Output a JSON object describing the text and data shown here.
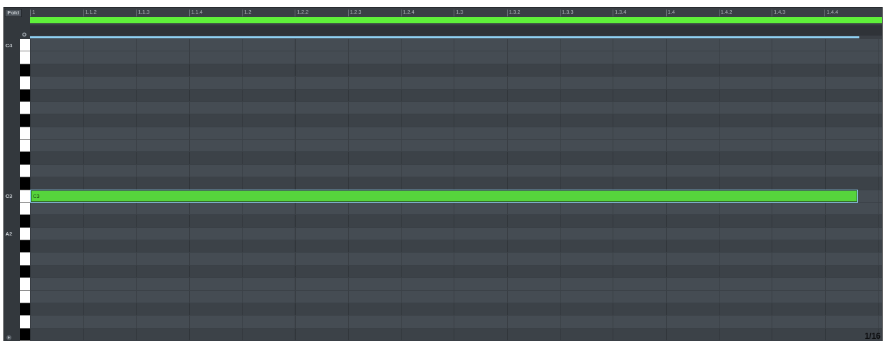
{
  "fold_button": "Fold",
  "ruler": [
    "1",
    "1.1.2",
    "1.1.3",
    "1.1.4",
    "1.2",
    "1.2.2",
    "1.2.3",
    "1.2.4",
    "1.3",
    "1.3.2",
    "1.3.3",
    "1.3.4",
    "1.4",
    "1.4.2",
    "1.4.3",
    "1.4.4"
  ],
  "keys": [
    {
      "kind": "white",
      "label": "C4"
    },
    {
      "kind": "white"
    },
    {
      "kind": "black"
    },
    {
      "kind": "white"
    },
    {
      "kind": "black"
    },
    {
      "kind": "white"
    },
    {
      "kind": "black"
    },
    {
      "kind": "white"
    },
    {
      "kind": "white"
    },
    {
      "kind": "black"
    },
    {
      "kind": "white"
    },
    {
      "kind": "black"
    },
    {
      "kind": "white",
      "label": "C3",
      "note": {
        "label": "C3",
        "selected": true
      }
    },
    {
      "kind": "white"
    },
    {
      "kind": "black"
    },
    {
      "kind": "white",
      "label": "A2"
    },
    {
      "kind": "black"
    },
    {
      "kind": "white"
    },
    {
      "kind": "black"
    },
    {
      "kind": "white"
    },
    {
      "kind": "white"
    },
    {
      "kind": "black"
    },
    {
      "kind": "white"
    },
    {
      "kind": "black"
    }
  ],
  "grid_resolution": "1/16"
}
